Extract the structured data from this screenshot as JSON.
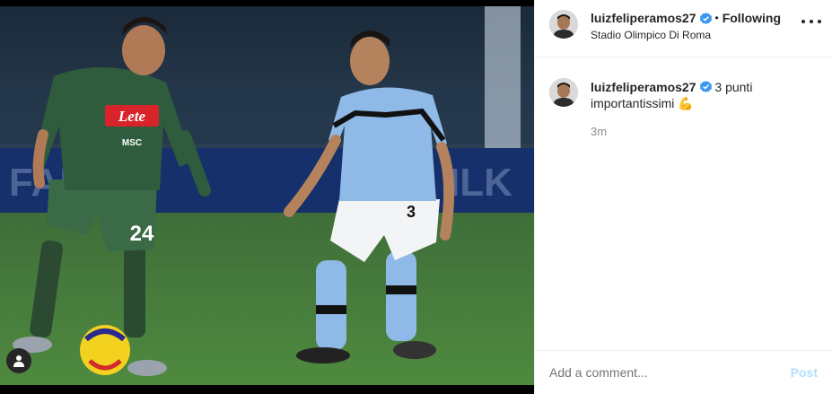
{
  "post": {
    "username": "luizfeliperamos27",
    "following_label": "Following",
    "separator": "•",
    "location": "Stadio Olimpico Di Roma",
    "caption_text": "3 punti importantissimi",
    "caption_emoji": "💪",
    "timestamp": "3m"
  },
  "photo": {
    "sponsor_text": "Lete",
    "jersey_number_left": "24",
    "jersey_number_right": "3",
    "sponsor_sub": "MSC"
  },
  "comment_box": {
    "placeholder": "Add a comment...",
    "post_label": "Post"
  },
  "colors": {
    "verified_blue": "#3897f0",
    "post_disabled": "#b2dffc",
    "napoli_green": "#2e5c3c",
    "lazio_sky": "#8fb9e6"
  },
  "icons": {
    "verified": "verified-badge-icon",
    "more": "more-options-icon",
    "tag": "user-tag-icon"
  }
}
